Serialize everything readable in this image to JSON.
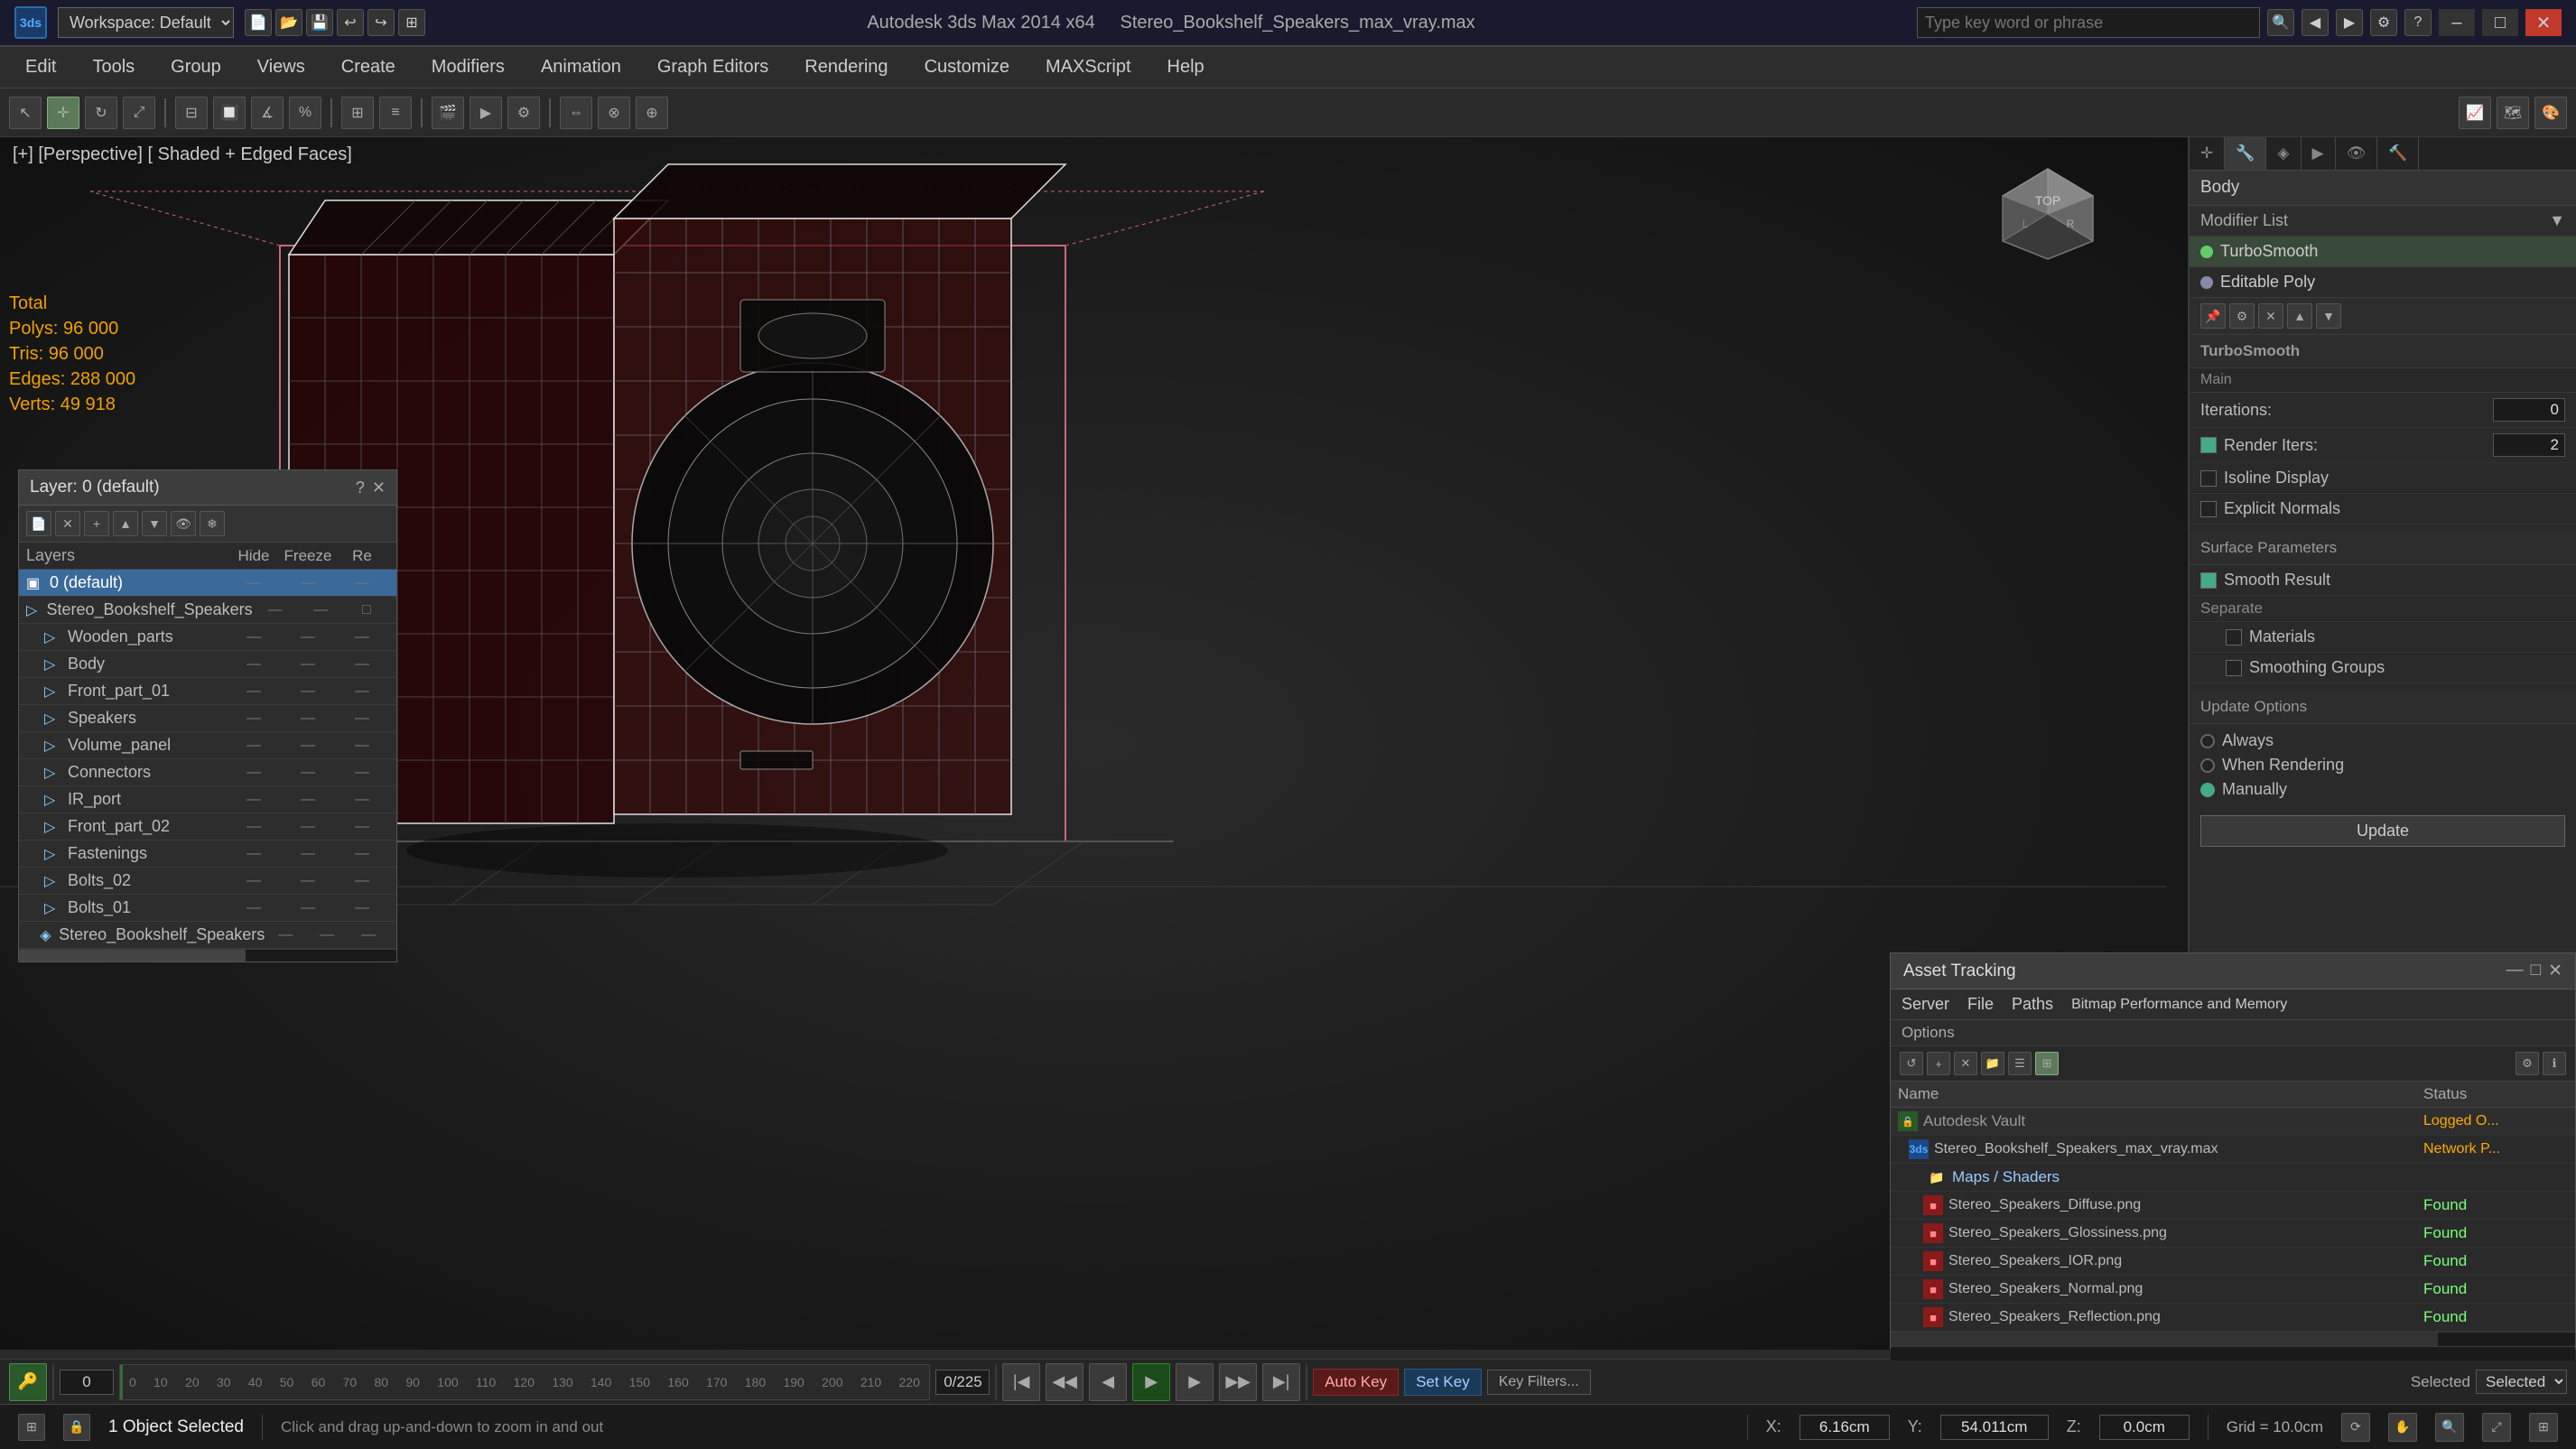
{
  "titlebar": {
    "app_name": "Autodesk 3ds Max 2014 x64",
    "file_name": "Stereo_Bookshelf_Speakers_max_vray.max",
    "workspace_label": "Workspace: Default",
    "search_placeholder": "Type key word or phrase",
    "window_min": "–",
    "window_max": "□",
    "window_close": "✕"
  },
  "menu": {
    "items": [
      "Edit",
      "Tools",
      "Group",
      "Views",
      "Create",
      "Modifiers",
      "Animation",
      "Graph Editors",
      "Rendering",
      "Customize",
      "MAXScript",
      "Help"
    ]
  },
  "viewport": {
    "label": "[+] [Perspective] [ Shaded + Edged Faces]",
    "stats": {
      "total_label": "Total",
      "polys_label": "Polys:",
      "polys_value": "96 000",
      "tris_label": "Tris:",
      "tris_value": "96 000",
      "edges_label": "Edges:",
      "edges_value": "288 000",
      "verts_label": "Verts:",
      "verts_value": "49 918"
    }
  },
  "layers_panel": {
    "title": "Layer: 0 (default)",
    "close_btn": "✕",
    "help_btn": "?",
    "headers": {
      "name": "Layers",
      "hide": "Hide",
      "freeze": "Freeze",
      "render": "Re"
    },
    "items": [
      {
        "id": "0",
        "name": "0 (default)",
        "level": 0,
        "selected": true,
        "type": "layer"
      },
      {
        "id": "1",
        "name": "Stereo_Bookshelf_Speakers",
        "level": 1,
        "selected": false,
        "type": "group"
      },
      {
        "id": "2",
        "name": "Wooden_parts",
        "level": 2,
        "selected": false,
        "type": "group"
      },
      {
        "id": "3",
        "name": "Body",
        "level": 2,
        "selected": false,
        "type": "group"
      },
      {
        "id": "4",
        "name": "Front_part_01",
        "level": 2,
        "selected": false,
        "type": "group"
      },
      {
        "id": "5",
        "name": "Speakers",
        "level": 2,
        "selected": false,
        "type": "group"
      },
      {
        "id": "6",
        "name": "Volume_panel",
        "level": 2,
        "selected": false,
        "type": "group"
      },
      {
        "id": "7",
        "name": "Connectors",
        "level": 2,
        "selected": false,
        "type": "group"
      },
      {
        "id": "8",
        "name": "IR_port",
        "level": 2,
        "selected": false,
        "type": "group"
      },
      {
        "id": "9",
        "name": "Front_part_02",
        "level": 2,
        "selected": false,
        "type": "group"
      },
      {
        "id": "10",
        "name": "Fastenings",
        "level": 2,
        "selected": false,
        "type": "group"
      },
      {
        "id": "11",
        "name": "Bolts_02",
        "level": 2,
        "selected": false,
        "type": "group"
      },
      {
        "id": "12",
        "name": "Bolts_01",
        "level": 2,
        "selected": false,
        "type": "group"
      },
      {
        "id": "13",
        "name": "Stereo_Bookshelf_Speakers",
        "level": 2,
        "selected": false,
        "type": "item"
      }
    ]
  },
  "modifier_panel": {
    "object_label": "Body",
    "modifier_list_label": "Modifier List",
    "modifiers": [
      {
        "name": "TurboSmooth",
        "active": true
      },
      {
        "name": "Editable Poly",
        "active": false
      }
    ],
    "sections": {
      "main_label": "TurboSmooth",
      "main_section": "Main",
      "iterations_label": "Iterations:",
      "iterations_value": "0",
      "render_iters_label": "Render Iters:",
      "render_iters_value": "2",
      "isoline_label": "Isoline Display",
      "explicit_normals_label": "Explicit Normals",
      "surface_params_label": "Surface Parameters",
      "smooth_result_label": "Smooth Result",
      "smooth_result_checked": true,
      "separate_label": "Separate",
      "materials_label": "Materials",
      "smoothing_groups_label": "Smoothing Groups",
      "update_options_label": "Update Options",
      "always_label": "Always",
      "when_rendering_label": "When Rendering",
      "manually_label": "Manually",
      "manually_selected": true,
      "update_label": "Update"
    }
  },
  "asset_panel": {
    "title": "Asset Tracking",
    "close_btn": "✕",
    "menu_items": [
      "Server",
      "File",
      "Paths",
      "Bitmap Performance and Memory"
    ],
    "options_label": "Options",
    "columns": {
      "name": "Name",
      "status": "Status"
    },
    "items": [
      {
        "id": "vault",
        "name": "Autodesk Vault",
        "level": 0,
        "type": "vault",
        "status": "Logged O..."
      },
      {
        "id": "max",
        "name": "Stereo_Bookshelf_Speakers_max_vray.max",
        "level": 1,
        "type": "max",
        "status": "Network P..."
      },
      {
        "id": "maps",
        "name": "Maps / Shaders",
        "level": 2,
        "type": "folder",
        "status": ""
      },
      {
        "id": "t1",
        "name": "Stereo_Speakers_Diffuse.png",
        "level": 3,
        "type": "texture",
        "status": "Found"
      },
      {
        "id": "t2",
        "name": "Stereo_Speakers_Glossiness.png",
        "level": 3,
        "type": "texture",
        "status": "Found"
      },
      {
        "id": "t3",
        "name": "Stereo_Speakers_IOR.png",
        "level": 3,
        "type": "texture",
        "status": "Found"
      },
      {
        "id": "t4",
        "name": "Stereo_Speakers_Normal.png",
        "level": 3,
        "type": "texture",
        "status": "Found"
      },
      {
        "id": "t5",
        "name": "Stereo_Speakers_Reflection.png",
        "level": 3,
        "type": "texture",
        "status": "Found"
      }
    ]
  },
  "timeline": {
    "start": "0",
    "end": "225",
    "current": "0",
    "ticks": [
      "0",
      "10",
      "20",
      "30",
      "40",
      "50",
      "60",
      "70",
      "80",
      "90",
      "100",
      "110",
      "120",
      "130",
      "140",
      "150",
      "160",
      "170",
      "180",
      "190",
      "200",
      "210",
      "220"
    ]
  },
  "status_bar": {
    "object_selected": "1 Object Selected",
    "hint": "Click and drag up-and-down to zoom in and out",
    "x_label": "X:",
    "x_value": "6.16cm",
    "y_label": "Y:",
    "y_value": "54.011cm",
    "z_label": "Z:",
    "z_value": "0.0cm",
    "grid_label": "Grid = 10.0cm",
    "auto_key": "Auto Key",
    "set_key": "Set Key",
    "key_filters_label": "Key Filters...",
    "selected_label": "Selected"
  },
  "icons": {
    "folder": "📁",
    "layer": "▣",
    "group": "◈",
    "object": "◇",
    "vault": "🔒",
    "texture_red": "■",
    "texture_green": "■",
    "new": "📄",
    "delete": "✕",
    "add": "+",
    "up": "▲",
    "down": "▼",
    "refresh": "↺",
    "settings": "⚙",
    "search": "🔍",
    "play": "▶",
    "prev_frame": "◀",
    "next_frame": "▶",
    "key": "🔑",
    "lock": "🔒",
    "move": "✛",
    "rotate": "↻",
    "scale": "⊞",
    "zoom_extent": "⤢",
    "render": "🎬",
    "camera": "📷"
  }
}
